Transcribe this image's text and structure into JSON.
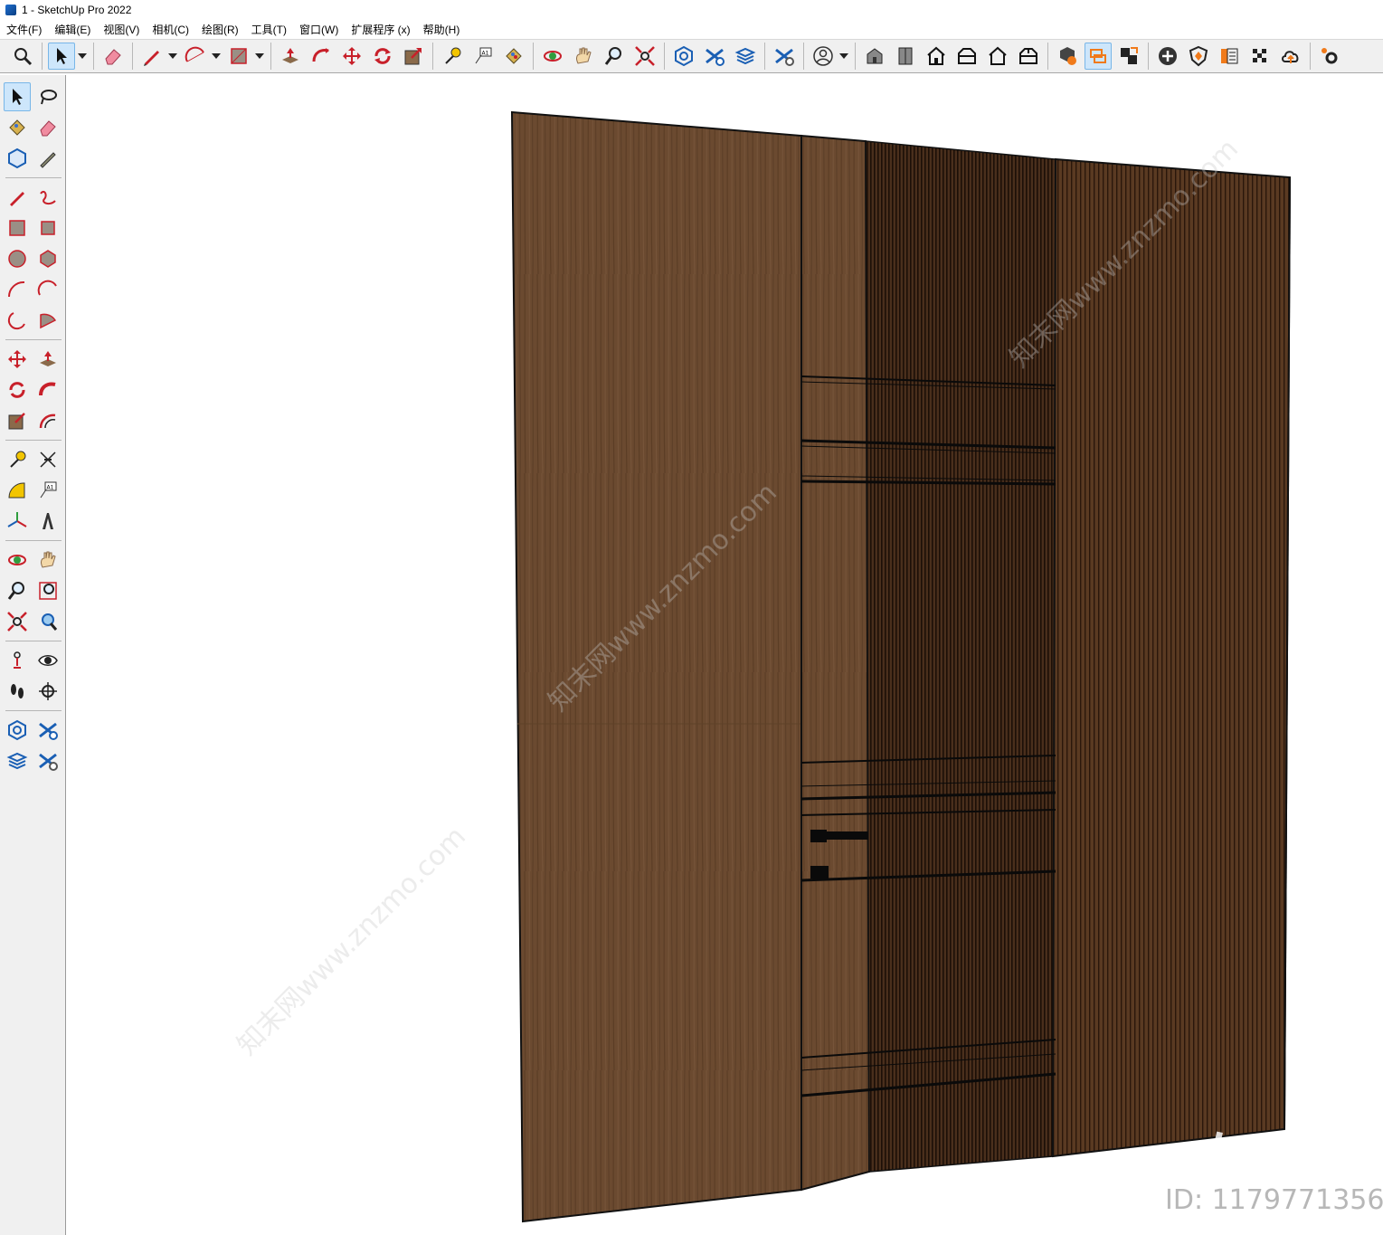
{
  "window": {
    "title": "1 - SketchUp Pro 2022"
  },
  "menu": [
    "文件(F)",
    "编辑(E)",
    "视图(V)",
    "相机(C)",
    "绘图(R)",
    "工具(T)",
    "窗口(W)",
    "扩展程序 (x)",
    "帮助(H)"
  ],
  "toolbar": {
    "active_tool": "select-tool",
    "items": [
      "zoom",
      "select",
      "eraser",
      "pencil",
      "arc",
      "rectangle",
      "push-pull",
      "follow-me",
      "move",
      "rotate",
      "scale",
      "tape-measure",
      "text",
      "paint-bucket",
      "orbit",
      "pan",
      "zoom-2",
      "zoom-extents",
      "warehouse",
      "extension-warehouse",
      "layout",
      "extension-manager",
      "account",
      "iso-view",
      "top-view",
      "front-view",
      "right-view",
      "back-view",
      "left-view",
      "solid-tools",
      "outer-shell",
      "intersect",
      "add-location",
      "style-builder",
      "materials",
      "shadows",
      "cloud",
      "settings"
    ]
  },
  "palette": {
    "active_tool": "select-tool"
  },
  "watermark": {
    "brand": "知末",
    "id_text": "ID: 1179771356",
    "diagonal_text": "知末网www.znzmo.com"
  },
  "colors": {
    "wood_light": "#6b4a30",
    "wood_dark": "#3a2416",
    "line_black": "#111111",
    "toolbar_bg": "#f0f0f0",
    "active_highlight": "#cde6fb"
  }
}
